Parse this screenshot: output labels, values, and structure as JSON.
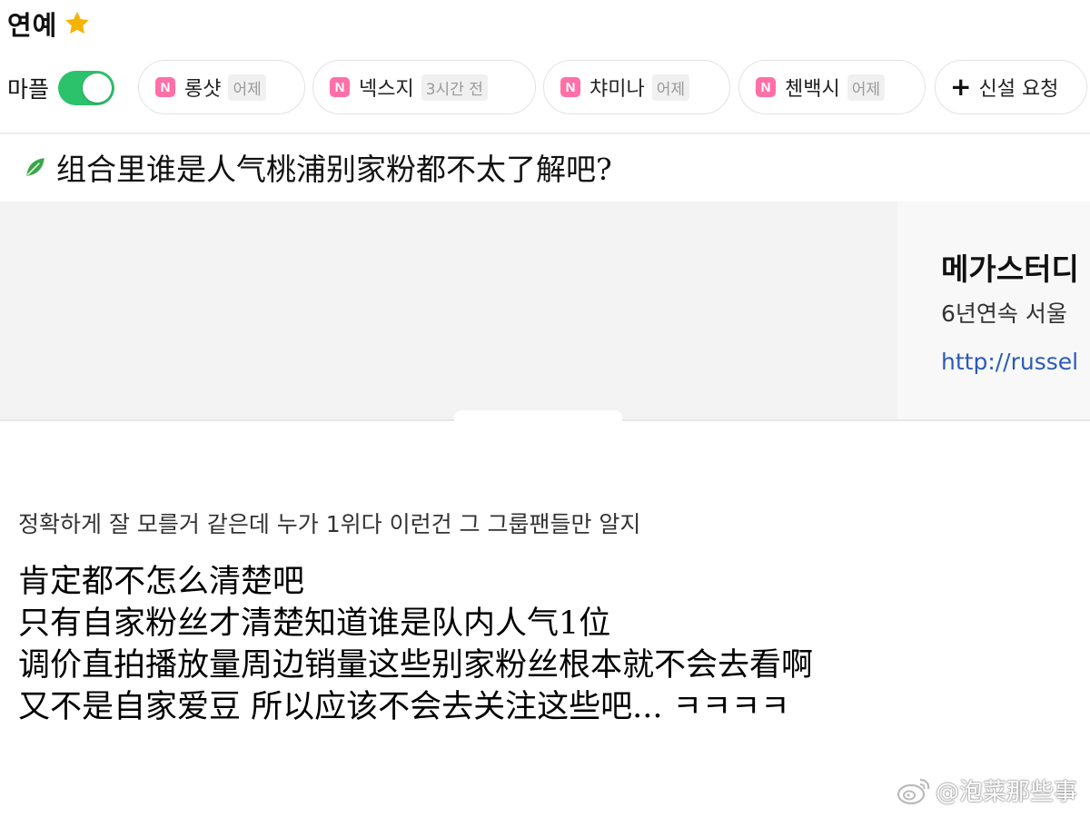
{
  "header": {
    "title": "연예"
  },
  "chip_row": {
    "toggle_label": "마플",
    "toggle_on": true,
    "chips": [
      {
        "badge": "N",
        "name": "롱샷",
        "time": "어제"
      },
      {
        "badge": "N",
        "name": "넥스지",
        "time": "3시간 전"
      },
      {
        "badge": "N",
        "name": "챠미나",
        "time": "어제"
      },
      {
        "badge": "N",
        "name": "첸백시",
        "time": "어제"
      }
    ],
    "request": {
      "icon": "+",
      "label": "신설 요청"
    }
  },
  "post": {
    "title": "组合里谁是人气桃浦别家粉都不太了解吧?"
  },
  "ad": {
    "title": "메가스터디",
    "subtitle": "6년연속 서울",
    "url": "http://russel"
  },
  "comment": {
    "korean": "정확하게 잘 모를거 같은데 누가 1위다 이런건 그 그룹팬들만 알지",
    "translation_lines": [
      "肯定都不怎么清楚吧",
      "只有自家粉丝才清楚知道谁是队内人气1位",
      "调价直拍播放量周边销量这些别家粉丝根本就不会去看啊",
      "又不是自家爱豆  所以应该不会去关注这些吧... ㅋㅋㅋㅋ"
    ]
  },
  "watermark": {
    "text": "@泡菜那些事"
  },
  "colors": {
    "toggle": "#2cc26b",
    "badge": "#ff6fa8",
    "star": "#f5b301",
    "leaf": "#3aa64a",
    "link": "#2b5bb8"
  }
}
